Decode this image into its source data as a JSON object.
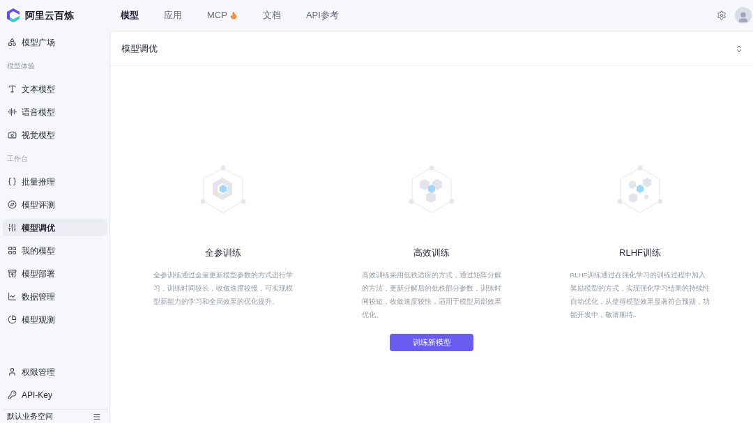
{
  "brand": {
    "name": "阿里云百炼"
  },
  "nav": [
    {
      "label": "模型",
      "selected": true,
      "hot": false
    },
    {
      "label": "应用",
      "selected": false,
      "hot": false
    },
    {
      "label": "MCP",
      "selected": false,
      "hot": true
    },
    {
      "label": "文档",
      "selected": false,
      "hot": false
    },
    {
      "label": "API参考",
      "selected": false,
      "hot": false
    }
  ],
  "sidebar": {
    "items": [
      {
        "kind": "item",
        "label": "模型广场",
        "selected": false
      },
      {
        "kind": "group",
        "label": "模型体验"
      },
      {
        "kind": "item",
        "label": "文本模型",
        "selected": false
      },
      {
        "kind": "item",
        "label": "语音模型",
        "selected": false
      },
      {
        "kind": "item",
        "label": "视觉模型",
        "selected": false
      },
      {
        "kind": "group",
        "label": "工作台"
      },
      {
        "kind": "item",
        "label": "批量推理",
        "selected": false
      },
      {
        "kind": "item",
        "label": "模型评测",
        "selected": false
      },
      {
        "kind": "item",
        "label": "模型调优",
        "selected": true
      },
      {
        "kind": "item",
        "label": "我的模型",
        "selected": false
      },
      {
        "kind": "item",
        "label": "模型部署",
        "selected": false
      },
      {
        "kind": "item",
        "label": "数据管理",
        "selected": false
      },
      {
        "kind": "item",
        "label": "模型观测",
        "selected": false
      }
    ],
    "bottom_items": [
      {
        "label": "权限管理",
        "selected": false
      },
      {
        "label": "API-Key",
        "selected": false
      }
    ],
    "workspace": "默认业务空间"
  },
  "panel": {
    "title": "模型调优",
    "cards": [
      {
        "title": "全参训练",
        "description": "全参训练通过全量更新模型参数的方式进行学习，训练时间较长，收敛速度较慢，可实现模型新能力的学习和全局效果的优化提升。"
      },
      {
        "title": "高效训练",
        "description": "高效训练采用低秩适应的方式，通过矩阵分解的方法，更新分解后的低秩部分参数，训练时间较短，收敛速度较快，适用于模型局部效果优化。"
      },
      {
        "title": "RLHF训练",
        "description": "RLHF训练通过在强化学习的训练过程中加入奖励模型的方式，实现强化学习结果的持续性自动优化，从使得模型效果显著符合预期，功能开发中，敬请期待.."
      }
    ],
    "button": "训练新模型"
  }
}
